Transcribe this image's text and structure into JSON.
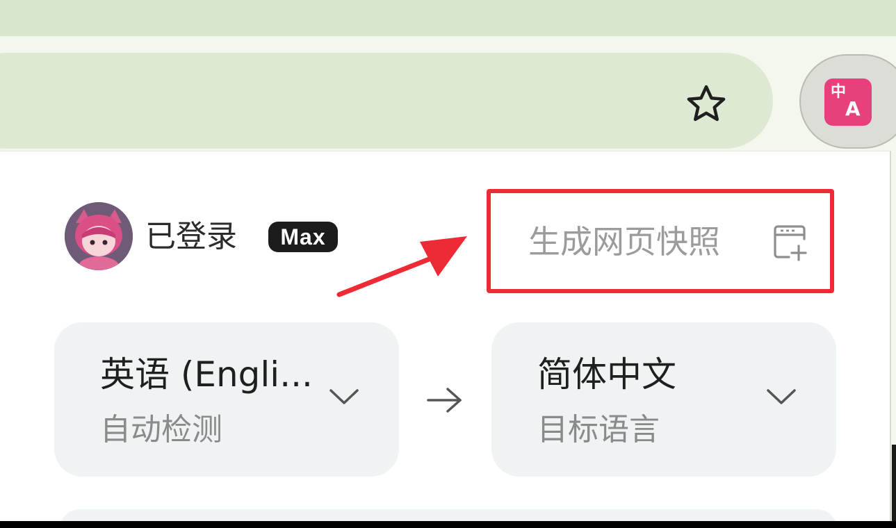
{
  "toolbar": {
    "bookmark_icon": "star-icon",
    "extension_icon": "translate-icon",
    "extension_glyph_top": "中",
    "extension_glyph_bottom": "A",
    "extension_color": "#e8407c"
  },
  "popup": {
    "login_status": "已登录",
    "plan_badge": "Max",
    "snapshot_button": "生成网页快照",
    "snapshot_icon": "snapshot-add-icon",
    "highlight_color": "#ee2a37",
    "source_language": {
      "name": "英语 (Engli...",
      "hint": "自动检测"
    },
    "target_language": {
      "name": "简体中文",
      "hint": "目标语言"
    },
    "swap_icon": "arrow-right-icon"
  }
}
